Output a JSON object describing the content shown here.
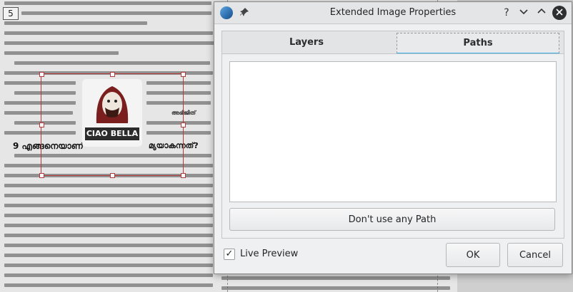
{
  "document": {
    "page_number": "5",
    "section_heading": "9 എങ്ങനെയാണ്",
    "section_heading_2": "മ്യയാകന്നത്?",
    "author_tag": "അഭിജിത്",
    "sticker_text": "CIAO BELLA"
  },
  "dialog": {
    "title": "Extended Image Properties",
    "titlebar": {
      "help": "?",
      "minimize": "⌄",
      "maximize": "⌃",
      "close": "✕",
      "pin": "📌"
    },
    "tabs": [
      {
        "label": "Layers",
        "active": false
      },
      {
        "label": "Paths",
        "active": true
      }
    ],
    "paths_list": [],
    "no_path_button": "Don't use any Path",
    "live_preview": {
      "label": "Live Preview",
      "checked": true,
      "check_glyph": "✓"
    },
    "ok_button": "OK",
    "cancel_button": "Cancel",
    "accent_color": "#3daee9"
  }
}
